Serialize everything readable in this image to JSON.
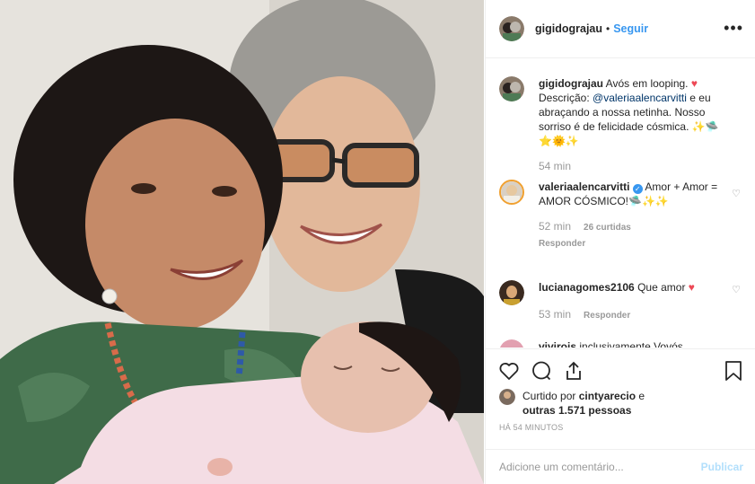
{
  "post": {
    "username": "gigidograjau",
    "follow_label": "Seguir",
    "more_label": "•••",
    "dot": "•"
  },
  "caption": {
    "username": "gigidograjau",
    "text_1": "Avós em looping. ",
    "heart": "♥",
    "text_2": "Descrição: ",
    "mention": "@valeriaalencarvitti",
    "text_3": " e eu abraçando a nossa netinha. Nosso sorriso é de felicidade cósmica. ✨🛸",
    "emoji_line": "⭐🌞✨",
    "time": "54 min"
  },
  "comments": [
    {
      "username": "valeriaalencarvitti",
      "verified": "✓",
      "text": "Amor + Amor = AMOR CÓSMICO!🛸✨✨",
      "time": "52 min",
      "likes": "26 curtidas",
      "reply": "Responder"
    },
    {
      "username": "lucianagomes2106",
      "text": "Que amor ",
      "heart": "♥",
      "time": "53 min",
      "reply": "Responder"
    },
    {
      "username": "vivirois",
      "text": "inclusivamente Vovós"
    }
  ],
  "likes": {
    "prefix": "Curtido por ",
    "user": "cintyarecio",
    "middle": " e",
    "others": "outras 1.571 pessoas"
  },
  "timestamp": "HÁ 54 MINUTOS",
  "add_comment": {
    "placeholder": "Adicione um comentário...",
    "publish": "Publicar"
  },
  "icons": {
    "like": "heart-outline-icon",
    "comment": "comment-bubble-icon",
    "share": "share-icon",
    "save": "bookmark-icon"
  },
  "colors": {
    "link": "#3897f0",
    "mention": "#003569",
    "heart_red": "#ed4956",
    "publish_disabled": "#b2dffc"
  }
}
